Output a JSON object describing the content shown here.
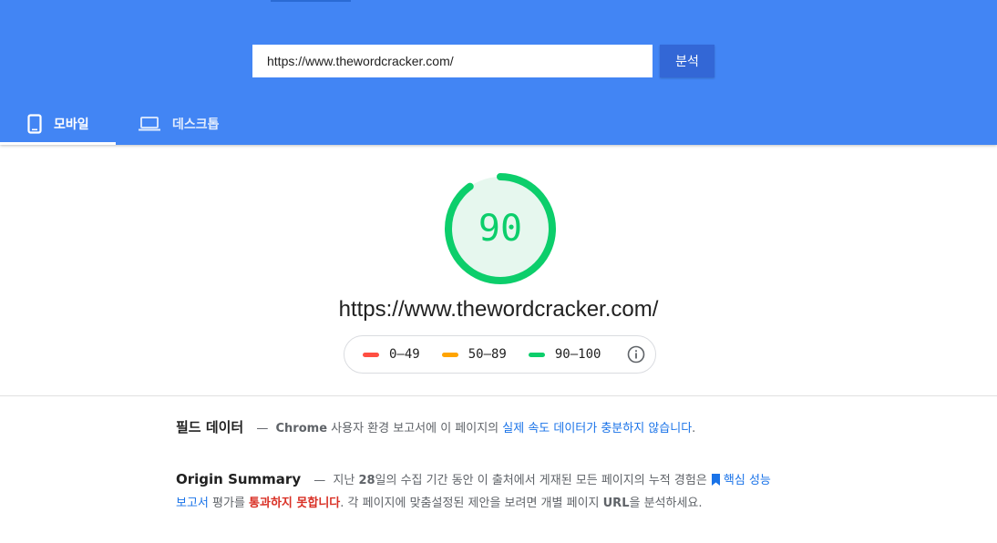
{
  "search": {
    "url_value": "https://www.thewordcracker.com/",
    "analyze_label": "분석"
  },
  "tabs": [
    {
      "label": "모바일",
      "icon": "smartphone-icon",
      "active": true
    },
    {
      "label": "데스크톱",
      "icon": "laptop-icon",
      "active": false
    }
  ],
  "score": {
    "value": "90",
    "fraction": 0.9,
    "color": "#0cce6b"
  },
  "page_url": "https://www.thewordcracker.com/",
  "legend": [
    {
      "range": "0–49",
      "color": "#ff4e42"
    },
    {
      "range": "50–89",
      "color": "#ffa400"
    },
    {
      "range": "90–100",
      "color": "#0cce6b"
    }
  ],
  "field_data": {
    "title": "필드 데이터",
    "dash": "—",
    "chrome": "Chrome",
    "text_before": " 사용자 환경 보고서에 이 페이지의 ",
    "link": "실제 속도 데이터가 충분하지 않습니다",
    "text_after": "."
  },
  "origin_summary": {
    "title": "Origin Summary",
    "dash": "—",
    "part1": " 지난 ",
    "days": "28",
    "part2": "일의 수집 기간 동안 이 출처에서 게재된 모든 페이지의 누적 경험은 ",
    "link": "핵심 성능 보고서",
    "part3": " 평가를 ",
    "fail": "통과하지 못합니다",
    "part4": ". 각 페이지에 맞춤설정된 제안을 보려면 개별 페이지 ",
    "url_word": "URL",
    "part5": "을 분석하세요."
  },
  "colors": {
    "header": "#4285f4",
    "button": "#3367d6",
    "pass": "#0cce6b",
    "average": "#ffa400",
    "fail": "#ff4e42",
    "link": "#1a73e8",
    "fail_text": "#d93025"
  }
}
